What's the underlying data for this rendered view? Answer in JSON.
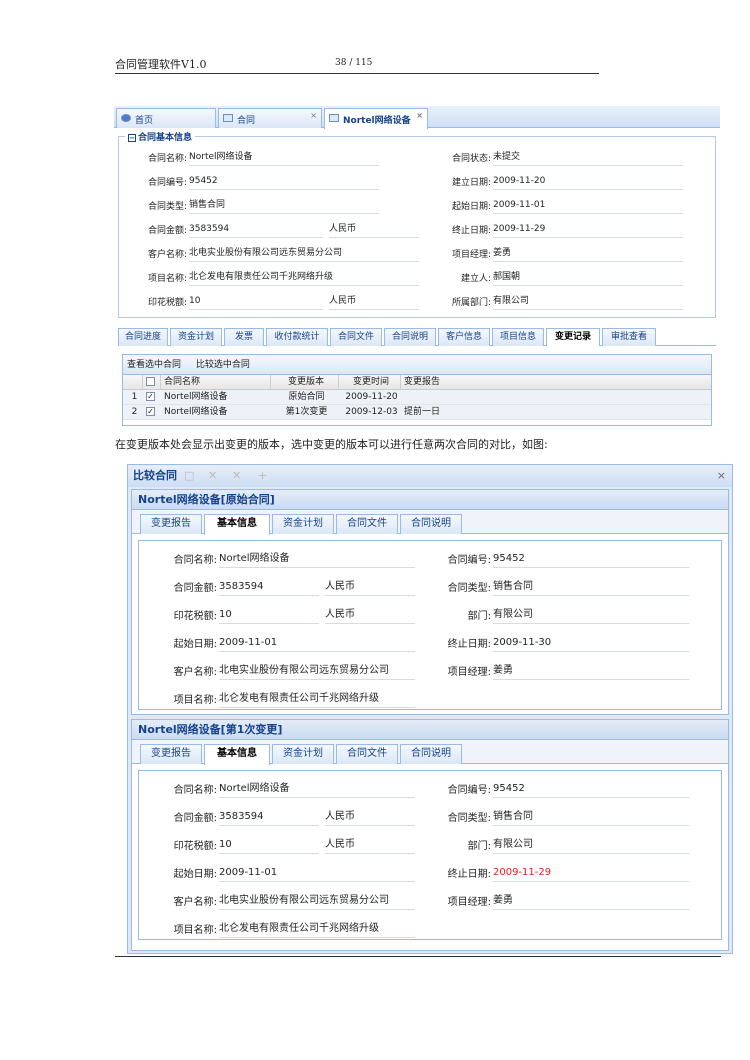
{
  "doc": {
    "title": "合同管理软件V1.0",
    "page": "38 / 115"
  },
  "shot1": {
    "tabs": [
      {
        "label": "首页"
      },
      {
        "label": "合同",
        "close": "×"
      },
      {
        "label": "Nortel网络设备",
        "close": "×"
      }
    ],
    "section_title": "合同基本信息",
    "section_toggle": "−",
    "fields": {
      "name": {
        "label": "合同名称:",
        "value": "Nortel网络设备"
      },
      "status": {
        "label": "合同状态:",
        "value": "未提交"
      },
      "number": {
        "label": "合同编号:",
        "value": "95452"
      },
      "created": {
        "label": "建立日期:",
        "value": "2009-11-20"
      },
      "type": {
        "label": "合同类型:",
        "value": "销售合同"
      },
      "start": {
        "label": "起始日期:",
        "value": "2009-11-01"
      },
      "amount": {
        "label": "合同金额:",
        "value": "3583594",
        "currency": "人民币"
      },
      "end": {
        "label": "终止日期:",
        "value": "2009-11-29"
      },
      "customer": {
        "label": "客户名称:",
        "value": "北电实业股份有限公司远东贸易分公司"
      },
      "manager": {
        "label": "项目经理:",
        "value": "姜勇"
      },
      "project": {
        "label": "项目名称:",
        "value": "北仑发电有限责任公司千兆网络升级"
      },
      "creator": {
        "label": "建立人:",
        "value": "郝国朝"
      },
      "stamp": {
        "label": "印花税额:",
        "value": "10",
        "currency": "人民币"
      },
      "dept": {
        "label": "所属部门:",
        "value": "有限公司"
      }
    },
    "subtabs": [
      "合同进度",
      "资金计划",
      "发票",
      "收付款统计",
      "合同文件",
      "合同说明",
      "客户信息",
      "项目信息",
      "变更记录",
      "审批查看"
    ],
    "grid": {
      "toolbar": [
        "查看选中合同",
        "比较选中合同"
      ],
      "columns": [
        "合同名称",
        "变更版本",
        "变更时间",
        "变更报告"
      ],
      "rows": [
        {
          "num": "1",
          "check": "✓",
          "name": "Nortel网络设备",
          "version": "原始合同",
          "time": "2009-11-20",
          "report": ""
        },
        {
          "num": "2",
          "check": "✓",
          "name": "Nortel网络设备",
          "version": "第1次变更",
          "time": "2009-12-03",
          "report": "提前一日"
        }
      ]
    }
  },
  "caption": "在变更版本处会显示出变更的版本，选中变更的版本可以进行任意两次合同的对比，如图:",
  "compare": {
    "title": "比较合同",
    "toolbar": [
      "□",
      "✕",
      "✕",
      "+"
    ],
    "close": "×",
    "panels": [
      {
        "header": "Nortel网络设备[原始合同]",
        "tabs": [
          "变更报告",
          "基本信息",
          "资金计划",
          "合同文件",
          "合同说明"
        ],
        "f": {
          "name": {
            "label": "合同名称:",
            "value": "Nortel网络设备"
          },
          "number": {
            "label": "合同编号:",
            "value": "95452"
          },
          "amount": {
            "label": "合同金额:",
            "value": "3583594",
            "currency": "人民币"
          },
          "type": {
            "label": "合同类型:",
            "value": "销售合同"
          },
          "stamp": {
            "label": "印花税额:",
            "value": "10",
            "currency": "人民币"
          },
          "dept": {
            "label": "部门:",
            "value": "有限公司"
          },
          "start": {
            "label": "起始日期:",
            "value": "2009-11-01"
          },
          "end": {
            "label": "终止日期:",
            "value": "2009-11-30"
          },
          "customer": {
            "label": "客户名称:",
            "value": "北电实业股份有限公司远东贸易分公司"
          },
          "manager": {
            "label": "项目经理:",
            "value": "姜勇"
          },
          "project": {
            "label": "项目名称:",
            "value": "北仑发电有限责任公司千兆网络升级"
          }
        }
      },
      {
        "header": "Nortel网络设备[第1次变更]",
        "tabs": [
          "变更报告",
          "基本信息",
          "资金计划",
          "合同文件",
          "合同说明"
        ],
        "f": {
          "name": {
            "label": "合同名称:",
            "value": "Nortel网络设备"
          },
          "number": {
            "label": "合同编号:",
            "value": "95452"
          },
          "amount": {
            "label": "合同金额:",
            "value": "3583594",
            "currency": "人民币"
          },
          "type": {
            "label": "合同类型:",
            "value": "销售合同"
          },
          "stamp": {
            "label": "印花税额:",
            "value": "10",
            "currency": "人民币"
          },
          "dept": {
            "label": "部门:",
            "value": "有限公司"
          },
          "start": {
            "label": "起始日期:",
            "value": "2009-11-01"
          },
          "end": {
            "label": "终止日期:",
            "value": "2009-11-29"
          },
          "customer": {
            "label": "客户名称:",
            "value": "北电实业股份有限公司远东贸易分公司"
          },
          "manager": {
            "label": "项目经理:",
            "value": "姜勇"
          },
          "project": {
            "label": "项目名称:",
            "value": "北仑发电有限责任公司千兆网络升级"
          }
        }
      }
    ],
    "changed_color": "#e02020"
  }
}
